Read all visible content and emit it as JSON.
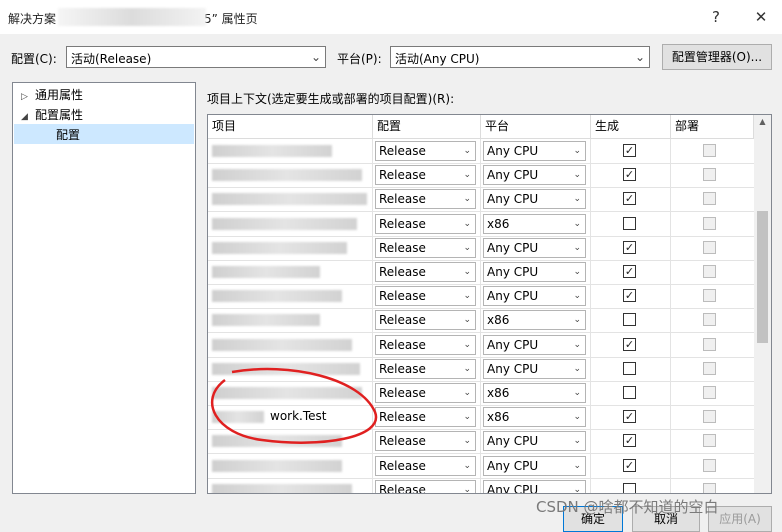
{
  "window": {
    "title_prefix": "解决方案",
    "title_suffix": "5” 属性页",
    "help_icon": "?",
    "close_icon": "✕"
  },
  "config_bar": {
    "config_label": "配置(C):",
    "config_value": "活动(Release)",
    "platform_label": "平台(P):",
    "platform_value": "活动(Any CPU)",
    "manager_button": "配置管理器(O)..."
  },
  "tree": {
    "items": [
      {
        "label": "通用属性",
        "expander": "▷"
      },
      {
        "label": "配置属性",
        "expander": "◢"
      },
      {
        "label": "配置",
        "expander": ""
      }
    ]
  },
  "grid": {
    "caption": "项目上下文(选定要生成或部署的项目配置)(R):",
    "columns": [
      "项目",
      "配置",
      "平台",
      "生成",
      "部署"
    ],
    "rows": [
      {
        "project": "",
        "config": "Release",
        "platform": "Any CPU",
        "build": true,
        "deploy": false
      },
      {
        "project": "",
        "config": "Release",
        "platform": "Any CPU",
        "build": true,
        "deploy": false
      },
      {
        "project": "",
        "config": "Release",
        "platform": "Any CPU",
        "build": true,
        "deploy": false
      },
      {
        "project": "",
        "config": "Release",
        "platform": "x86",
        "build": false,
        "deploy": false
      },
      {
        "project": "",
        "config": "Release",
        "platform": "Any CPU",
        "build": true,
        "deploy": false
      },
      {
        "project": "",
        "config": "Release",
        "platform": "Any CPU",
        "build": true,
        "deploy": false
      },
      {
        "project": "",
        "config": "Release",
        "platform": "Any CPU",
        "build": true,
        "deploy": false
      },
      {
        "project": "",
        "config": "Release",
        "platform": "x86",
        "build": false,
        "deploy": false
      },
      {
        "project": "",
        "config": "Release",
        "platform": "Any CPU",
        "build": true,
        "deploy": false
      },
      {
        "project": "",
        "config": "Release",
        "platform": "Any CPU",
        "build": false,
        "deploy": false
      },
      {
        "project": "",
        "config": "Release",
        "platform": "x86",
        "build": false,
        "deploy": false
      },
      {
        "project": "work.Test",
        "config": "Release",
        "platform": "x86",
        "build": true,
        "deploy": false
      },
      {
        "project": "",
        "config": "Release",
        "platform": "Any CPU",
        "build": true,
        "deploy": false
      },
      {
        "project": "",
        "config": "Release",
        "platform": "Any CPU",
        "build": true,
        "deploy": false
      },
      {
        "project": "",
        "config": "Release",
        "platform": "Any CPU",
        "build": false,
        "deploy": false
      }
    ],
    "check_mark": "✓",
    "dropdown_arrow": "⌄"
  },
  "footer": {
    "ok": "确定",
    "cancel": "取消",
    "apply": "应用(A)",
    "watermark": "CSDN @啥都不知道的空白"
  },
  "colors": {
    "selection": "#cde8ff",
    "annotation": "#e02020"
  }
}
